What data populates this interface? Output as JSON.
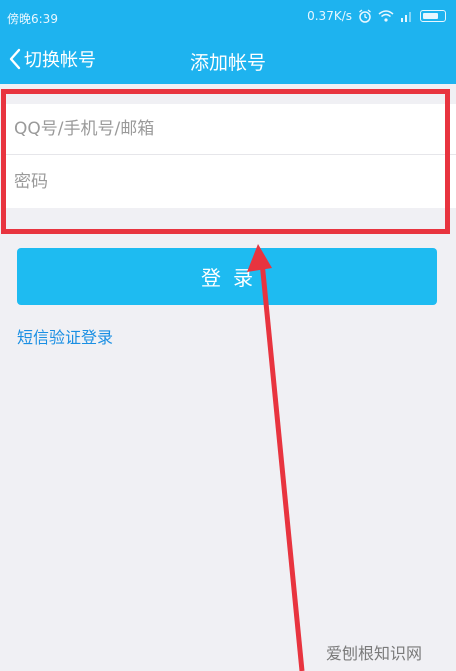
{
  "status_bar": {
    "time": "傍晚6:39",
    "speed": "0.37K/s",
    "icons": [
      "alarm-icon",
      "wifi-icon",
      "signal-icon",
      "battery-icon"
    ]
  },
  "nav": {
    "back_label": "切换帐号",
    "title": "添加帐号"
  },
  "form": {
    "account_placeholder": "QQ号/手机号/邮箱",
    "password_placeholder": "密码"
  },
  "login_button": "登录",
  "sms_login_link": "短信验证登录",
  "watermark": "爱刨根知识网",
  "colors": {
    "brand_blue": "#1eb3ef",
    "button_blue": "#1ebbf1",
    "link_blue": "#1a8fe3",
    "annotation_red": "#e8343f",
    "background": "#f0f0f4"
  }
}
